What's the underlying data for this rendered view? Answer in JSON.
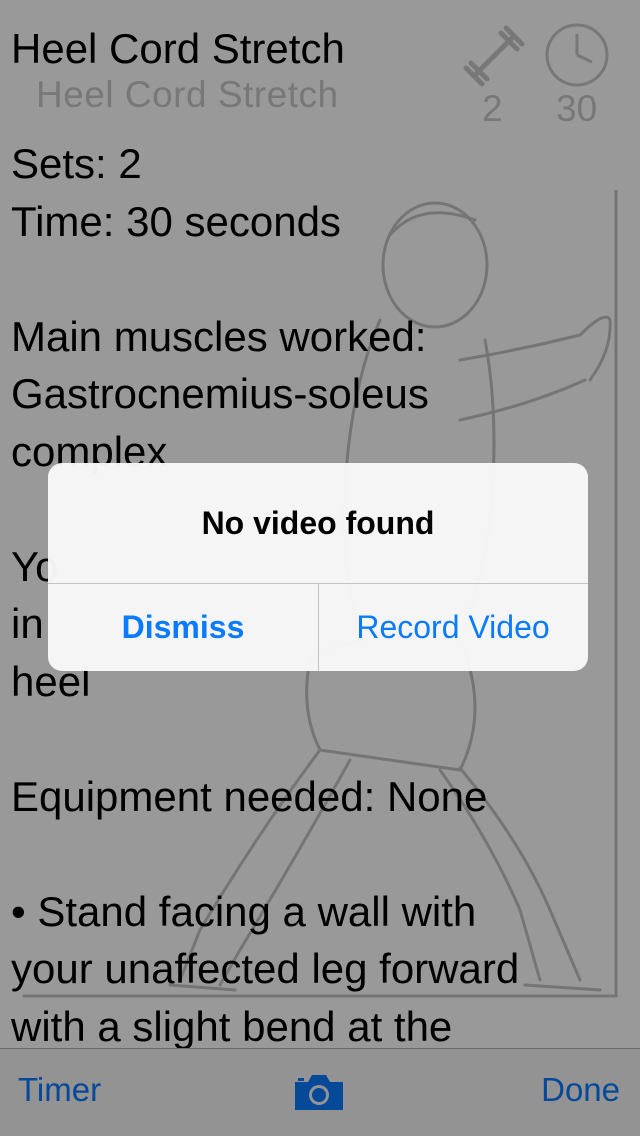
{
  "header": {
    "background_title": "Heel Cord Stretch",
    "sets_value": "2",
    "time_value": "30"
  },
  "content": {
    "title": "Heel Cord Stretch",
    "sets": "Sets: 2",
    "time": "Time: 30 seconds",
    "muscles_line1": "Main muscles worked:",
    "muscles_line2": "Gastrocnemius-soleus",
    "muscles_line3": "complex",
    "obscured_line1": "Yo",
    "obscured_line2": "in",
    "obscured_line3": "heel",
    "equipment": "Equipment needed: None",
    "step_line1": "• Stand facing a wall with",
    "step_line2": "your unaffected leg forward",
    "step_line3": "with a slight bend at the"
  },
  "alert": {
    "title": "No video found",
    "dismiss_label": "Dismiss",
    "record_label": "Record Video"
  },
  "toolbar": {
    "timer_label": "Timer",
    "camera_icon": "camera-icon",
    "done_label": "Done"
  },
  "colors": {
    "accent": "#0a7aff",
    "overlay": "rgba(0,0,0,0.40)",
    "toolbar_bg": "#f6f6f6"
  }
}
